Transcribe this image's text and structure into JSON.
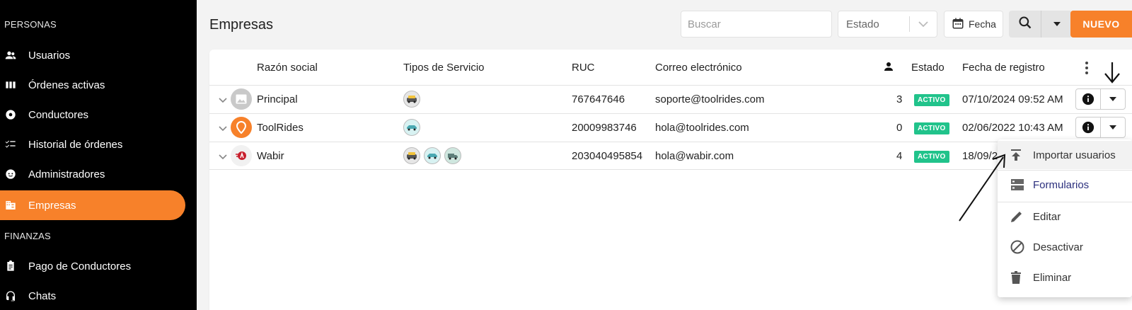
{
  "sidebar": {
    "section_personas": "PERSONAS",
    "section_finanzas": "FINANZAS",
    "items": [
      {
        "label": "Usuarios",
        "icon": "users-icon"
      },
      {
        "label": "Órdenes activas",
        "icon": "columns-icon"
      },
      {
        "label": "Conductores",
        "icon": "steering-wheel-icon"
      },
      {
        "label": "Historial de órdenes",
        "icon": "checklist-icon"
      },
      {
        "label": "Administradores",
        "icon": "face-icon"
      },
      {
        "label": "Empresas",
        "icon": "building-icon",
        "active": true
      },
      {
        "label": "Pago de Conductores",
        "icon": "clipboard-icon"
      },
      {
        "label": "Chats",
        "icon": "headset-icon"
      }
    ]
  },
  "header": {
    "title": "Empresas",
    "search_placeholder": "Buscar",
    "estado_label": "Estado",
    "fecha_label": "Fecha",
    "nuevo_label": "NUEVO"
  },
  "table": {
    "columns": [
      "Razón social",
      "Tipos de Servicio",
      "RUC",
      "Correo electrónico",
      "Estado",
      "Fecha de registro"
    ],
    "rows": [
      {
        "name": "Principal",
        "ruc": "767647646",
        "email": "soporte@toolrides.com",
        "users": "3",
        "estado": "ACTIVO",
        "fecha": "07/10/2024 09:52 AM"
      },
      {
        "name": "ToolRides",
        "ruc": "20009983746",
        "email": "hola@toolrides.com",
        "users": "0",
        "estado": "ACTIVO",
        "fecha": "02/06/2022 10:43 AM"
      },
      {
        "name": "Wabir",
        "ruc": "203040495854",
        "email": "hola@wabir.com",
        "users": "4",
        "estado": "ACTIVO",
        "fecha": "18/09/2"
      }
    ]
  },
  "menu": {
    "items": [
      "Importar usuarios",
      "Formularios",
      "Editar",
      "Desactivar",
      "Eliminar"
    ]
  },
  "colors": {
    "accent": "#f7812a",
    "active_badge": "#21c38b",
    "link": "#2b2f7d"
  }
}
